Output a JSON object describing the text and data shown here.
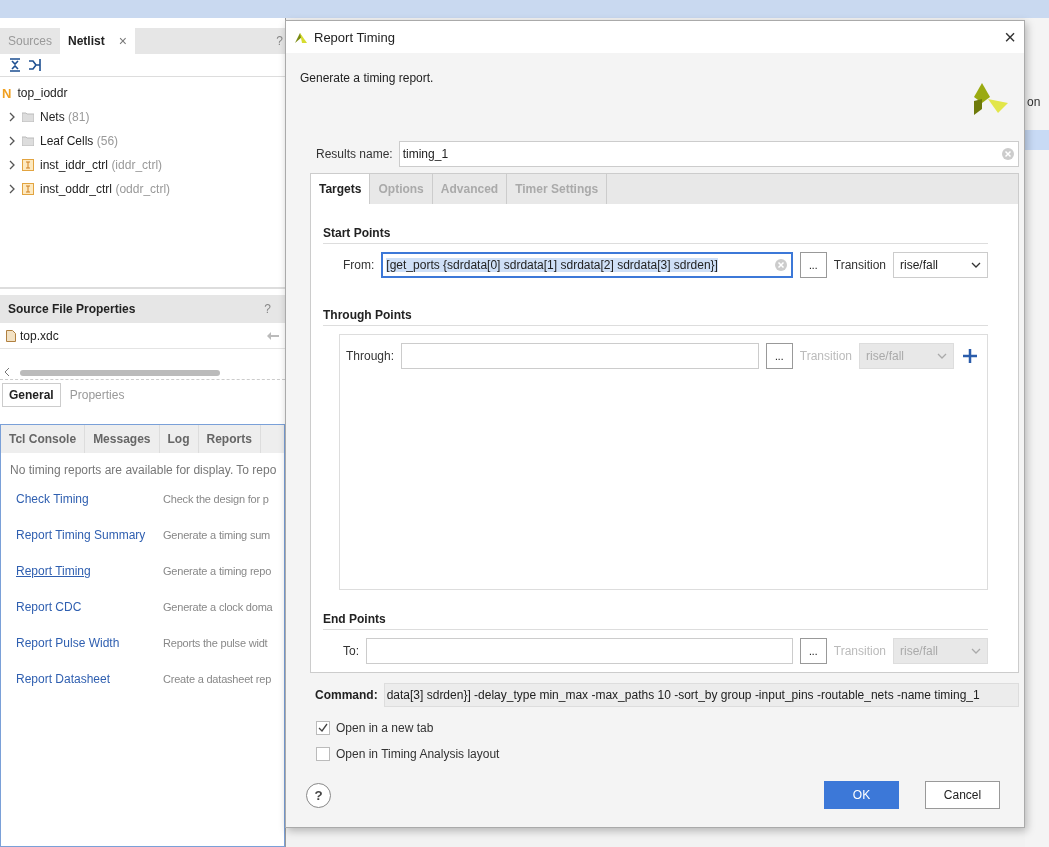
{
  "left_panel": {
    "tabs": [
      {
        "label": "Sources",
        "selected": false
      },
      {
        "label": "Netlist",
        "selected": true,
        "closable": true
      }
    ],
    "close_glyph": "×",
    "help": "?",
    "tree": {
      "label": "top_ioddr",
      "badge": "N",
      "children": [
        {
          "label": "Nets",
          "count": "(81)",
          "kind": "folder",
          "expanded": false
        },
        {
          "label": "Leaf Cells",
          "count": "(56)",
          "kind": "folder",
          "expanded": false
        },
        {
          "label": "inst_iddr_ctrl",
          "count": "(iddr_ctrl)",
          "kind": "cell",
          "expanded": false
        },
        {
          "label": "inst_oddr_ctrl",
          "count": "(oddr_ctrl)",
          "kind": "cell",
          "expanded": false
        }
      ]
    }
  },
  "source_file_properties": {
    "title": "Source File Properties",
    "help": "?",
    "file": "top.xdc",
    "tabs": [
      {
        "label": "General",
        "selected": true
      },
      {
        "label": "Properties",
        "selected": false
      }
    ]
  },
  "bottom_panel": {
    "tabs": [
      {
        "label": "Tcl Console"
      },
      {
        "label": "Messages"
      },
      {
        "label": "Log"
      },
      {
        "label": "Reports"
      }
    ],
    "message": "No timing reports are available for display. To repo",
    "links": [
      {
        "label": "Check Timing",
        "description": "Check the design for p",
        "hovered": false
      },
      {
        "label": "Report Timing Summary",
        "description": "Generate a timing sum",
        "hovered": false
      },
      {
        "label": "Report Timing",
        "description": "Generate a timing repo",
        "hovered": true
      },
      {
        "label": "Report CDC",
        "description": "Generate a clock doma",
        "hovered": false
      },
      {
        "label": "Report Pulse Width",
        "description": "Reports the pulse widt",
        "hovered": false
      },
      {
        "label": "Report Datasheet",
        "description": "Create a datasheet rep",
        "hovered": false
      }
    ]
  },
  "right_strip": {
    "column_header": "on"
  },
  "dialog": {
    "title": "Report Timing",
    "close_glyph": "×",
    "description": "Generate a timing report.",
    "results_name": {
      "label": "Results name:",
      "value": "timing_1"
    },
    "tabs": [
      {
        "label": "Targets",
        "selected": true
      },
      {
        "label": "Options",
        "selected": false
      },
      {
        "label": "Advanced",
        "selected": false
      },
      {
        "label": "Timer Settings",
        "selected": false
      }
    ],
    "sections": [
      {
        "title": "Start Points",
        "label": "From:",
        "value": "[get_ports {sdrdata[0] sdrdata[1] sdrdata[2] sdrdata[3] sdrden}]",
        "text_selected": true,
        "browse": "...",
        "transition_label": "Transition",
        "transition": "rise/fall",
        "disabled": false,
        "boxed": false
      },
      {
        "title": "Through Points",
        "label": "Through:",
        "browse": "...",
        "transition_label": "Transition",
        "transition": "rise/fall",
        "disabled": true,
        "boxed": true,
        "add": true
      },
      {
        "title": "End Points",
        "label": "To:",
        "browse": "...",
        "transition_label": "Transition",
        "transition": "rise/fall",
        "disabled": true,
        "boxed": false
      }
    ],
    "command": {
      "label": "Command:",
      "value": "data[3] sdrden}] -delay_type min_max -max_paths 10 -sort_by group -input_pins -routable_nets -name timing_1"
    },
    "options": [
      {
        "label": "Open in a new tab",
        "checked": true
      },
      {
        "label": "Open in Timing Analysis layout",
        "checked": false
      }
    ],
    "help": "?",
    "buttons": [
      {
        "label": "OK",
        "primary": true
      },
      {
        "label": "Cancel",
        "primary": false
      }
    ]
  }
}
